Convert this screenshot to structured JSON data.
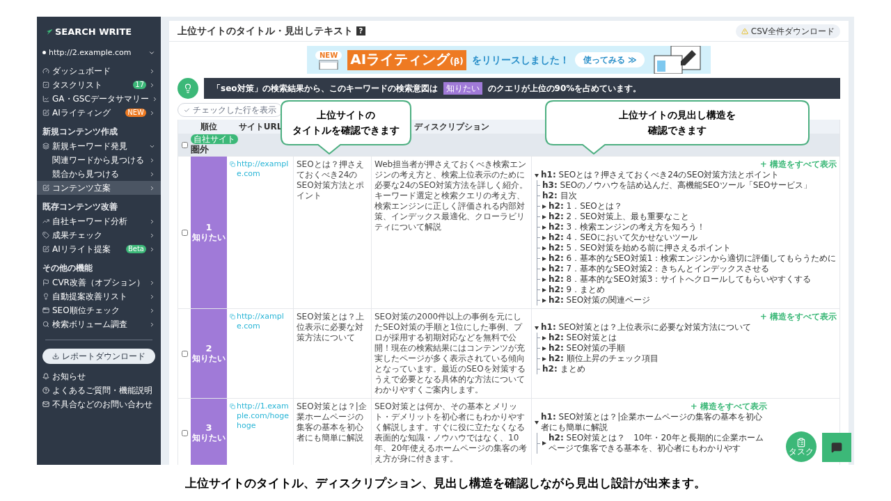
{
  "sidebar": {
    "logo": "SEARCH WRITE",
    "site": "http://2.example.com",
    "items": [
      {
        "kind": "item",
        "label": "ダッシュボード",
        "selected": false
      },
      {
        "kind": "item",
        "label": "タスクリスト",
        "selected": false,
        "badge": {
          "text": "17",
          "color": "#3cb878"
        }
      },
      {
        "kind": "item",
        "label": "GA・GSCデータサマリー",
        "selected": false
      },
      {
        "kind": "item",
        "label": "AIライティング",
        "selected": false,
        "badge": {
          "text": "NEW",
          "color": "#ee7a22"
        }
      },
      {
        "kind": "section",
        "label": "新規コンテンツ作成"
      },
      {
        "kind": "item",
        "label": "新規キーワード発見",
        "selected": false,
        "expanded": true
      },
      {
        "kind": "subitem",
        "label": "関連ワードから見つける",
        "selected": false
      },
      {
        "kind": "subitem",
        "label": "競合から見つける",
        "selected": false
      },
      {
        "kind": "item",
        "label": "コンテンツ立案",
        "selected": true
      },
      {
        "kind": "section",
        "label": "既存コンテンツ改善"
      },
      {
        "kind": "item",
        "label": "自社キーワード分析",
        "selected": false
      },
      {
        "kind": "item",
        "label": "成果チェック",
        "selected": false
      },
      {
        "kind": "item",
        "label": "AIリライト提案",
        "selected": false,
        "badge": {
          "text": "Beta",
          "color": "#3cb878"
        }
      },
      {
        "kind": "section",
        "label": "その他の機能"
      },
      {
        "kind": "item",
        "label": "CVR改善（オプション）",
        "selected": false
      },
      {
        "kind": "item",
        "label": "自動提案改善リスト",
        "selected": false
      },
      {
        "kind": "item",
        "label": "SEO順位チェック",
        "selected": false
      },
      {
        "kind": "item",
        "label": "検索ボリューム調査",
        "selected": false
      }
    ],
    "report_button": "レポートダウンロード",
    "footer": [
      "お知らせ",
      "よくあるご質問・機能説明",
      "不具合などのお問い合わせ"
    ]
  },
  "page": {
    "title": "上位サイトのタイトル・見出しテキスト",
    "help": "?",
    "csv_button": "CSV全件ダウンロード"
  },
  "banner": {
    "new": "NEW",
    "title": "AIライティング",
    "suffix": "(β)",
    "text": "をリリースしました！",
    "button": "使ってみる ≫"
  },
  "insight": {
    "before": "「seo対策」の検索結果から、このキーワードの検索意図は",
    "tag": "知りたい",
    "after": "のクエリが上位の90%を占めています。"
  },
  "filter_button": "チェックした行を表示",
  "table": {
    "columns": [
      {},
      {
        "label": "順位"
      },
      {
        "label": "サイトURL"
      },
      {},
      {
        "label": "ディスクリプション"
      },
      {}
    ],
    "own_site": {
      "badge": "自社サイト",
      "rank": "圏外",
      "checked": false
    },
    "rows": [
      {
        "rank": "1",
        "intent": "知りたい",
        "color": "#a07ad8",
        "checked": false,
        "url": "http://example.com",
        "title": "SEOとは？押さえておくべき24のSEO対策方法とポイント",
        "description": "Web担当者が押さえておくべき検索エンジンの考え方と、検索上位表示のために必要な24のSEO対策方法を詳しく紹介。キーワード選定と検索クエリの考え方、検索エンジンに正しく評価される内部対策、インデックス最適化、クローラビリティについて解説",
        "expand": "+ 構造をすべて表示",
        "headings": [
          {
            "kind": "group",
            "expanded": true,
            "text": "**h1:** SEOとは？押さえておくべき24のSEO対策方法とポイント",
            "children": [
              {
                "kind": "leaf",
                "text": "**h3:** SEOのノウハウを詰め込んだ、高機能SEOツール「SEOサービス」"
              },
              {
                "kind": "leaf",
                "text": "**h2:** 目次"
              },
              {
                "kind": "group",
                "expanded": false,
                "text": "**h2:** 1．SEOとは？"
              },
              {
                "kind": "group",
                "expanded": false,
                "text": "**h2:** 2．SEO対策上、最も重要なこと"
              },
              {
                "kind": "group",
                "expanded": false,
                "text": "**h2:** 3．検索エンジンの考え方を知ろう！"
              },
              {
                "kind": "group",
                "expanded": false,
                "text": "**h2:** 4．SEOにおいて欠かせないツール"
              },
              {
                "kind": "group",
                "expanded": false,
                "text": "**h2:** 5．SEO対策を始める前に押さえるポイント"
              },
              {
                "kind": "group",
                "expanded": false,
                "text": "**h2:** 6．基本的なSEO対策1：検索エンジンから適切に評価してもらうために"
              },
              {
                "kind": "group",
                "expanded": false,
                "text": "**h2:** 7．基本的なSEO対策2：きちんとインデックスさせる"
              },
              {
                "kind": "group",
                "expanded": false,
                "text": "**h2:** 8．基本的なSEO対策3：サイトへクロールしてもらいやすくする"
              },
              {
                "kind": "group",
                "expanded": false,
                "text": "**h2:** 9．まとめ"
              },
              {
                "kind": "group",
                "expanded": false,
                "text": "**h2:** SEO対策の関連ページ"
              }
            ]
          }
        ]
      },
      {
        "rank": "2",
        "intent": "知りたい",
        "color": "#a07ad8",
        "checked": false,
        "url": "http://xample.com",
        "title": "SEO対策とは？上位表示に必要な対策方法について",
        "description": "SEO対策の2000件以上の事例を元にしたSEO対策の手順と1位にした事例、プロが採用する初期対応などを無料で公開！現在の検索結果にはコンテンツが充実したページが多く表示されている傾向となっています。最近のSEOを対策するうえで必要となる具体的な方法についてわかりやすくご案内します。",
        "expand": "+ 構造をすべて表示",
        "headings": [
          {
            "kind": "group",
            "expanded": true,
            "text": "**h1:** SEO対策とは？上位表示に必要な対策方法について",
            "children": [
              {
                "kind": "group",
                "expanded": false,
                "text": "**h2:** SEO対策とは"
              },
              {
                "kind": "group",
                "expanded": false,
                "text": "**h2:** SEO対策の手順"
              },
              {
                "kind": "group",
                "expanded": false,
                "text": "**h2:** 順位上昇のチェック項目"
              },
              {
                "kind": "leaf",
                "text": "**h2:** まとめ"
              }
            ]
          }
        ]
      },
      {
        "rank": "3",
        "intent": "知りたい",
        "color": "#a07ad8",
        "checked": false,
        "url": "http://1.example.com/hogehoge",
        "title": "SEO対策とは？|企業ホームページの集客の基本を初心者にも簡単に解説",
        "description": "SEO対策とは何か、その基本とメリット・デメリットを初心者にもわかりやすく解説します。すぐに役に立たなくなる表面的な知識・ノウハウではなく、10年、20年使えるホームページの集客の考え方が身に付きます。",
        "expand": "+ 構造をすべて表示",
        "headings": [
          {
            "kind": "group",
            "expanded": true,
            "text": "**h1:** SEO対策とは？|企業ホームページの集客の基本を初心者にも簡単に解説",
            "children": [
              {
                "kind": "group",
                "expanded": false,
                "text": "**h2:** SEO対策とは？　10年・20年と長期的に企業ホームページで集客できる基本を、初心者にもわかりやす"
              }
            ]
          }
        ]
      }
    ]
  },
  "callouts": [
    {
      "lines": [
        "上位サイトの",
        "タイトルを確認できます"
      ]
    },
    {
      "lines": [
        "上位サイトの見出し構造を",
        "確認できます"
      ]
    }
  ],
  "task_button": "タスク",
  "caption": "上位サイトのタイトル、ディスクリプション、見出し構造を確認しながら見出し設計が出来ます。"
}
